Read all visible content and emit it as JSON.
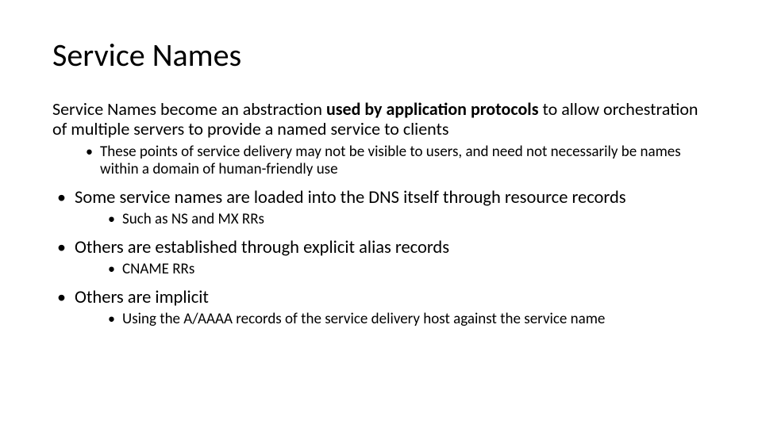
{
  "title": "Service Names",
  "intro": {
    "pre": "Service Names become an abstraction ",
    "bold": "used by application protocols",
    "post": " to allow orchestration of multiple servers to provide a named service to clients"
  },
  "introSub": "These points of service delivery may not be visible to users, and need not necessarily be names within a domain of human-friendly use",
  "bullets": [
    {
      "text": "Some service names are loaded into the DNS itself through resource records",
      "sub": [
        "Such as NS and MX RRs"
      ]
    },
    {
      "text": "Others are established through explicit alias records",
      "sub": [
        "CNAME RRs"
      ]
    },
    {
      "text": "Others are implicit",
      "sub": [
        "Using the A/AAAA records of the service delivery host against the service name"
      ]
    }
  ]
}
